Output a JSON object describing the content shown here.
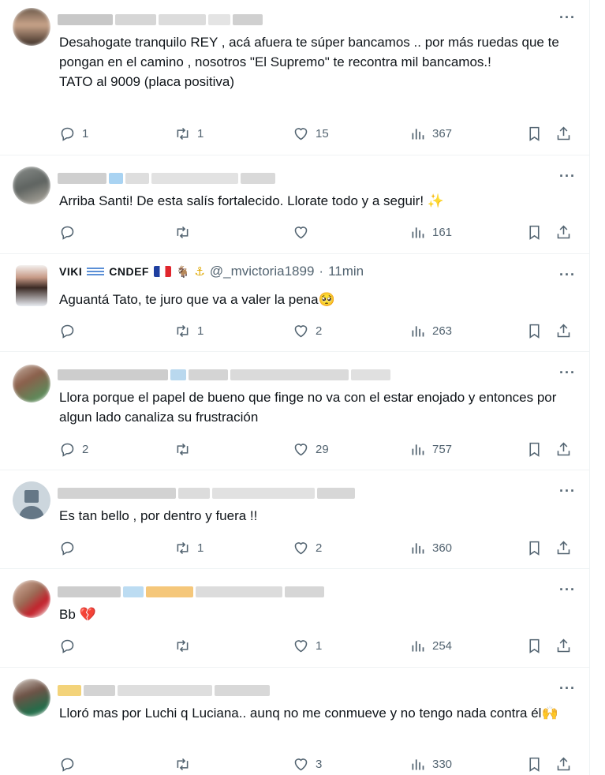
{
  "more_label": "···",
  "posts": [
    {
      "text": "Desahogate tranquilo REY , acá afuera te súper bancamos .. por más ruedas que te pongan en el camino , nosotros \"El Supremo\" te recontra mil bancamos.!\nTATO al 9009 (placa positiva)",
      "replies": "1",
      "reposts": "1",
      "likes": "15",
      "views": "367"
    },
    {
      "text": "Arriba Santi! De esta salís fortalecido. Llorate todo y a seguir! ✨",
      "replies": "",
      "reposts": "",
      "likes": "",
      "views": "161"
    },
    {
      "name": "VIKI",
      "name2": "CNDEF",
      "handle": "@_mvictoria1899",
      "sep": "·",
      "time": "11min",
      "text": "Aguantá Tato, te juro que va a valer la pena🥺",
      "replies": "",
      "reposts": "1",
      "likes": "2",
      "views": "263"
    },
    {
      "text": "Llora porque el papel de bueno que finge no va con el estar enojado y entonces por algun lado canaliza su frustración",
      "replies": "2",
      "reposts": "",
      "likes": "29",
      "views": "757"
    },
    {
      "text": "Es tan bello , por dentro y fuera !!",
      "replies": "",
      "reposts": "1",
      "likes": "2",
      "views": "360"
    },
    {
      "text": "Bb 💔",
      "replies": "",
      "reposts": "",
      "likes": "1",
      "views": "254"
    },
    {
      "text": "Lloró mas por Luchi q Luciana.. aunq no me conmueve y no tengo nada contra él🙌",
      "replies": "",
      "reposts": "",
      "likes": "3",
      "views": "330"
    }
  ]
}
